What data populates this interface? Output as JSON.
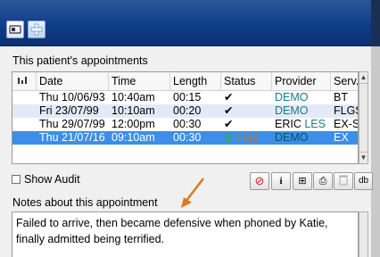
{
  "toolbar": {
    "icons": [
      "contact-card-icon",
      "medical-cross-icon"
    ]
  },
  "appointments": {
    "section_title": "This patient's appointments",
    "columns": {
      "icon": "",
      "date": "Date",
      "time": "Time",
      "length": "Length",
      "status": "Status",
      "provider": "Provider",
      "service": "Serv..."
    },
    "rows": [
      {
        "date": "Thu 10/06/93",
        "time": "10:40am",
        "length": "00:15",
        "status": "✔",
        "status_text": "",
        "provider_a": "DEMO",
        "provider_b": "",
        "service": "BT"
      },
      {
        "date": "Fri 23/07/99",
        "time": "10:10am",
        "length": "00:20",
        "status": "✔",
        "status_text": "",
        "provider_a": "DEMO",
        "provider_b": "",
        "service": "FLGS"
      },
      {
        "date": "Thu 29/07/99",
        "time": "12:00pm",
        "length": "00:30",
        "status": "✔",
        "status_text": "",
        "provider_a": "ERIC",
        "provider_b": "LES",
        "service": "EX-SP"
      },
      {
        "date": "Thu 21/07/16",
        "time": "09:10am",
        "length": "00:30",
        "status": "⊘",
        "status_text": "Fear",
        "provider_a": "DEMO",
        "provider_b": "",
        "service": "EX"
      }
    ]
  },
  "audit": {
    "label": "Show Audit",
    "checked": false
  },
  "action_buttons": [
    {
      "icon": "cancel-icon",
      "glyph": "⊘",
      "color": "#d02020"
    },
    {
      "icon": "info-icon",
      "glyph": "i",
      "color": "#000000"
    },
    {
      "icon": "grid-edit-icon",
      "glyph": "⊞",
      "color": "#333333"
    },
    {
      "icon": "print-icon",
      "glyph": "⎙",
      "color": "#333333"
    },
    {
      "icon": "trash-icon",
      "glyph": "🗑",
      "color": "#aaaaaa"
    },
    {
      "icon": "db-icon",
      "glyph": "db",
      "color": "#333333"
    }
  ],
  "notes": {
    "section_title": "Notes about this appointment",
    "text": "Failed to arrive, then became defensive when phoned by Katie, finally admitted being terrified."
  },
  "colors": {
    "selection": "#3d8ee8",
    "header": "#0f3d8a",
    "annotation_arrow": "#e07820"
  }
}
